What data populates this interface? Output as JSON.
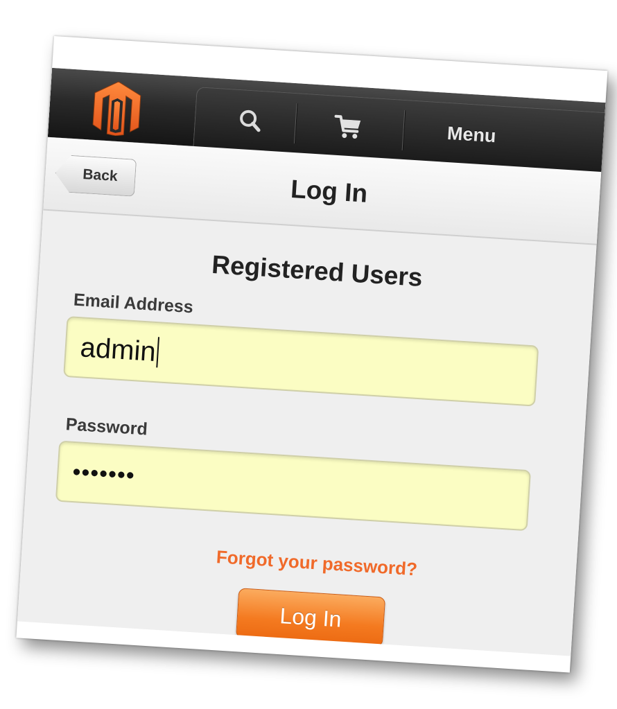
{
  "header": {
    "logo_icon": "magento-logo-icon",
    "search_icon": "search-icon",
    "cart_icon": "cart-icon",
    "menu_label": "Menu"
  },
  "titlebar": {
    "back_label": "Back",
    "title": "Log In"
  },
  "login_form": {
    "section_title": "Registered Users",
    "email_label": "Email Address",
    "email_value": "admin",
    "password_label": "Password",
    "password_value": "•••••••",
    "forgot_link": "Forgot your password?",
    "login_button": "Log In"
  },
  "colors": {
    "header_dark": "#1b1b1b",
    "accent_orange": "#f47a20",
    "link_orange": "#f06a2a",
    "input_yellow": "#fbfdc3",
    "logo_orange": "#f26322"
  }
}
